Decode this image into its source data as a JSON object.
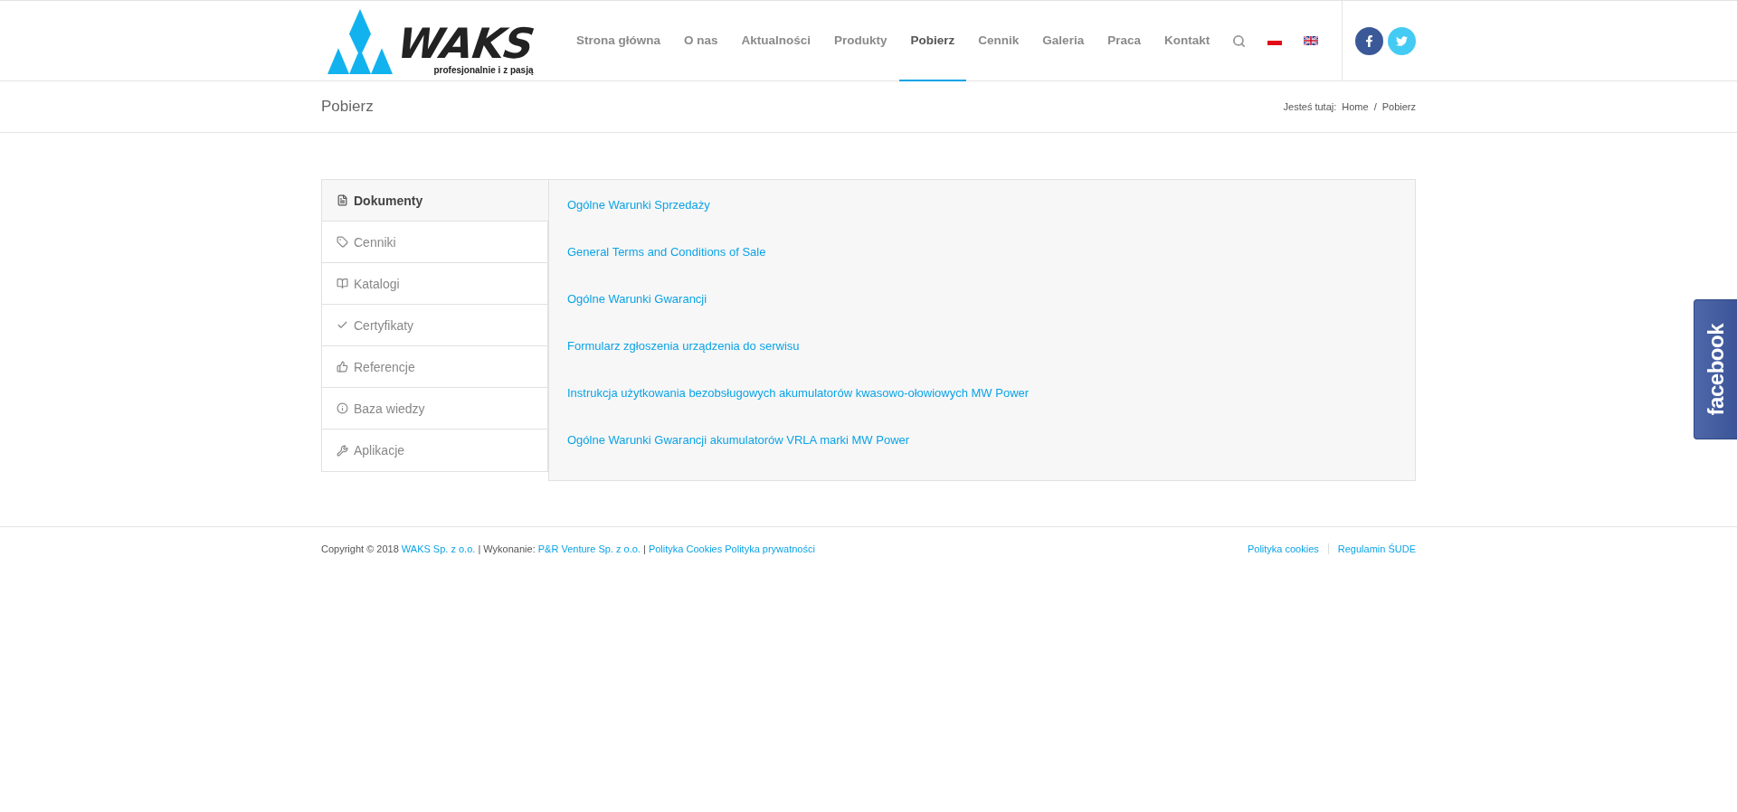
{
  "logo": {
    "name": "WAKS",
    "tagline": "profesjonalnie i z pasją"
  },
  "nav": [
    {
      "label": "Strona główna",
      "selected": false
    },
    {
      "label": "O nas",
      "selected": false
    },
    {
      "label": "Aktualności",
      "selected": false
    },
    {
      "label": "Produkty",
      "selected": false
    },
    {
      "label": "Pobierz",
      "selected": true
    },
    {
      "label": "Cennik",
      "selected": false
    },
    {
      "label": "Galeria",
      "selected": false
    },
    {
      "label": "Praca",
      "selected": false
    },
    {
      "label": "Kontakt",
      "selected": false
    }
  ],
  "page_title": "Pobierz",
  "breadcrumb": {
    "label": "Jesteś tutaj:",
    "separator": "/",
    "items": [
      "Home",
      "Pobierz"
    ]
  },
  "tabs": [
    {
      "label": "Dokumenty",
      "kind": "document",
      "selected": true
    },
    {
      "label": "Cenniki",
      "kind": "tag",
      "selected": false
    },
    {
      "label": "Katalogi",
      "kind": "book",
      "selected": false
    },
    {
      "label": "Certyfikaty",
      "kind": "check",
      "selected": false
    },
    {
      "label": "Referencje",
      "kind": "thumb",
      "selected": false
    },
    {
      "label": "Baza wiedzy",
      "kind": "info",
      "selected": false
    },
    {
      "label": "Aplikacje",
      "kind": "tools",
      "selected": false
    }
  ],
  "documents": [
    "Ogólne Warunki Sprzedaży",
    "General Terms and Conditions of Sale",
    "Ogólne Warunki Gwarancji",
    "Formularz zgłoszenia urządzenia do serwisu",
    "Instrukcja użytkowania bezobsługowych akumulatorów kwasowo-ołowiowych MW Power",
    "Ogólne Warunki Gwarancji akumulatorów VRLA marki MW Power"
  ],
  "footer": {
    "copyright": [
      {
        "text": "Copyright © 2018",
        "kind": "text"
      },
      {
        "text": "WAKS Sp. z o.o.",
        "kind": "link"
      },
      {
        "text": "| Wykonanie:",
        "kind": "text"
      },
      {
        "text": "P&R Venture Sp. z o.o.",
        "kind": "link"
      },
      {
        "text": "|",
        "kind": "text"
      },
      {
        "text": "Polityka Cookies",
        "kind": "link"
      },
      {
        "text": "Polityka prywatności",
        "kind": "link"
      }
    ],
    "links": [
      "Polityka cookies",
      "Regulamin ŚUDE"
    ]
  },
  "facebook_tab": {
    "label": "facebook"
  }
}
